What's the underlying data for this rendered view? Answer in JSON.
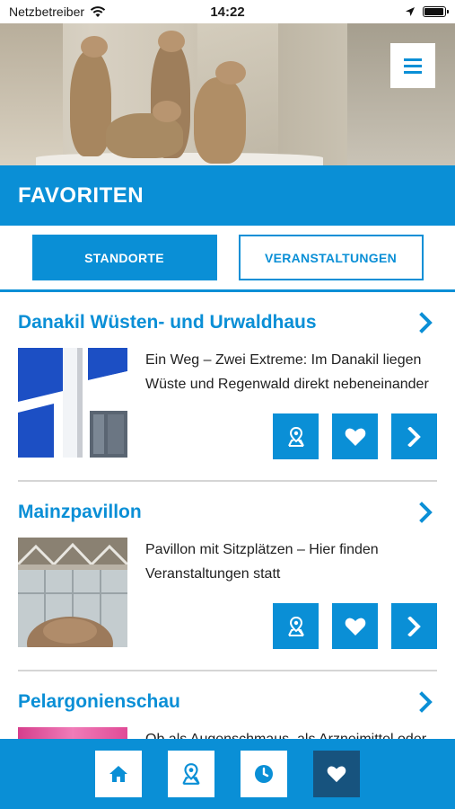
{
  "status_bar": {
    "carrier": "Netzbetreiber",
    "time": "14:22"
  },
  "header": {
    "menu_icon": "hamburger-menu-icon",
    "title": "FAVORITEN"
  },
  "tabs": [
    {
      "label": "STANDORTE",
      "active": true
    },
    {
      "label": "VERANSTALTUNGEN",
      "active": false
    }
  ],
  "favorites": [
    {
      "title": "Danakil Wüsten- und Urwaldhaus",
      "description": "Ein Weg – Zwei Extreme: Im Danakil liegen Wüste und Regenwald direkt nebeneinander"
    },
    {
      "title": "Mainzpavillon",
      "description": "Pavillon mit Sitzplätzen – Hier finden Veranstaltungen statt"
    },
    {
      "title": "Pelargonienschau",
      "description": "Ob als Augenschmaus, als Arzneimittel oder als"
    }
  ],
  "card_actions": [
    "map-pin-icon",
    "heart-icon",
    "chevron-right-icon"
  ],
  "bottom_nav": [
    {
      "icon": "home-icon",
      "active": false
    },
    {
      "icon": "map-pin-icon",
      "active": false
    },
    {
      "icon": "clock-icon",
      "active": false
    },
    {
      "icon": "heart-icon",
      "active": true
    }
  ],
  "colors": {
    "primary": "#0a8fd6",
    "active_nav": "#17537e",
    "divider": "#d5d5d5"
  }
}
